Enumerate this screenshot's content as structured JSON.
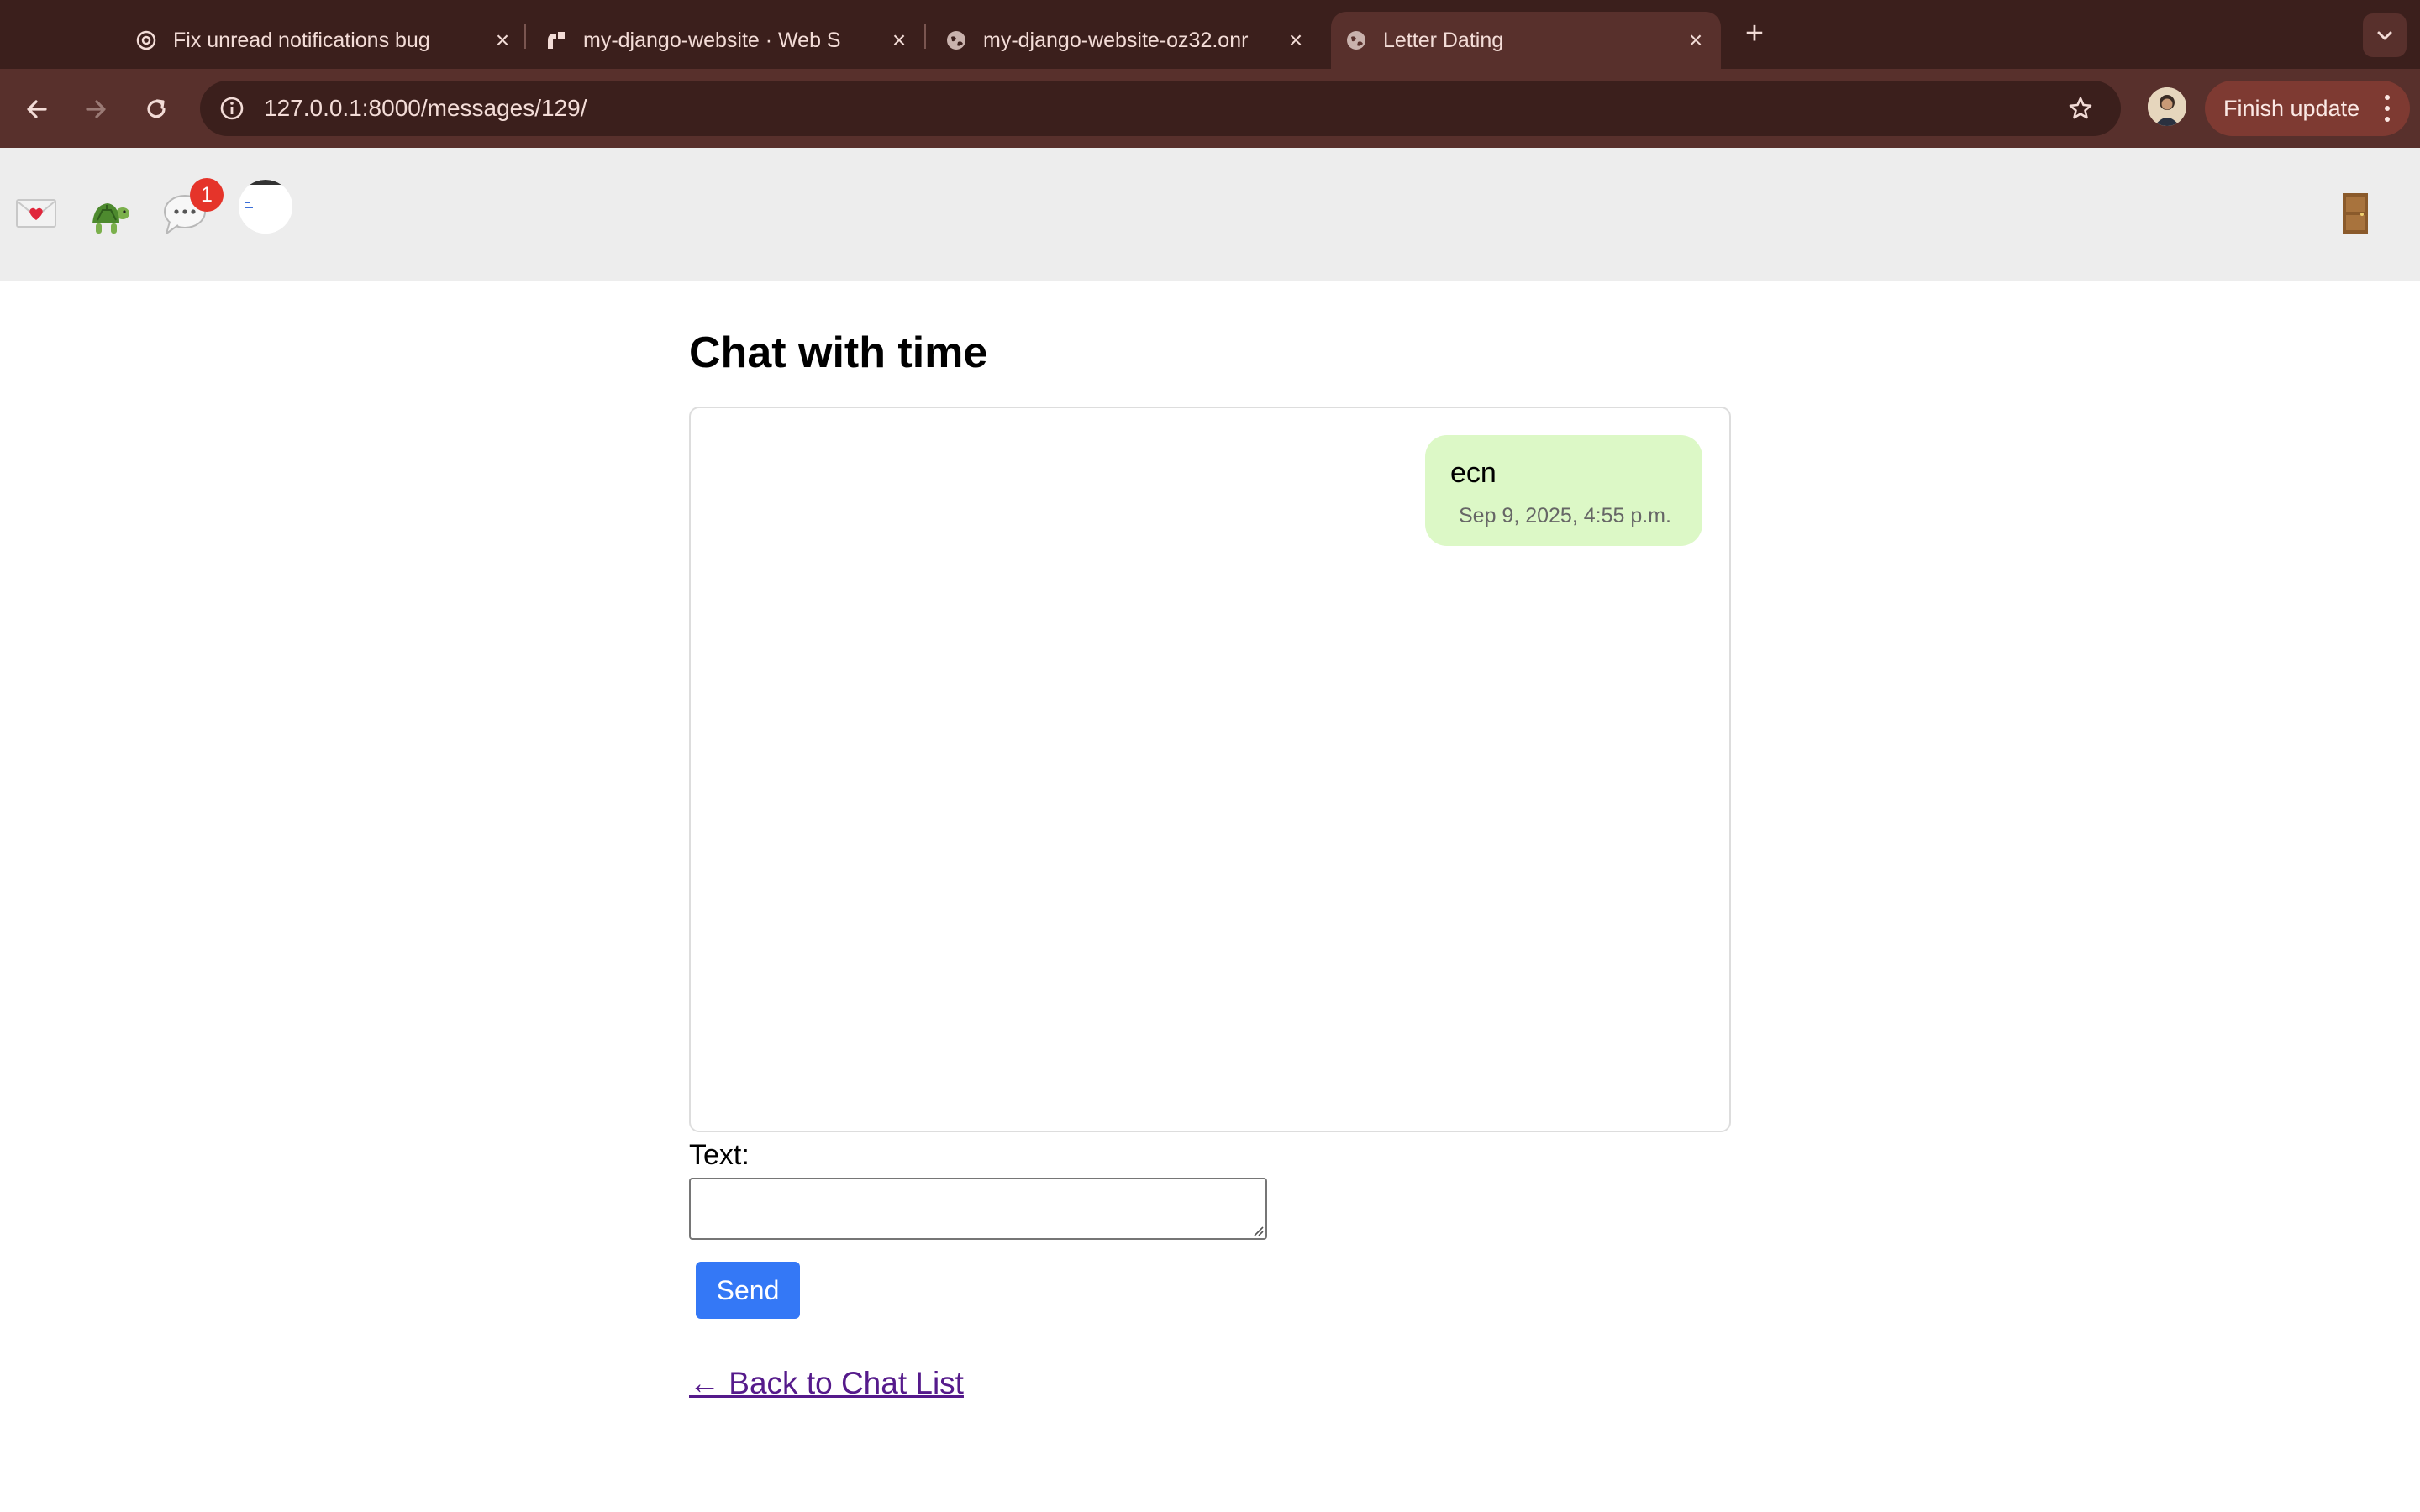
{
  "browser": {
    "tabs": [
      {
        "title": "Fix unread notifications bug",
        "icon": "openai-icon",
        "active": false
      },
      {
        "title": "my-django-website · Web S",
        "icon": "render-icon",
        "active": false
      },
      {
        "title": "my-django-website-oz32.onr",
        "icon": "globe-icon",
        "active": false
      },
      {
        "title": "Letter Dating",
        "icon": "globe-icon",
        "active": true
      }
    ],
    "url": "127.0.0.1:8000/messages/129/",
    "finish_update_label": "Finish update",
    "colors": {
      "tabbar": "#3b1f1c",
      "toolbar": "#58302c",
      "finish_update": "#7e3a32"
    }
  },
  "site_header": {
    "nav_icons": [
      "love-letter-icon",
      "turtle-icon",
      "speech-bubble-icon",
      "user-avatar",
      "door-icon"
    ],
    "unread_count": "1"
  },
  "page": {
    "title": "Chat with time",
    "messages": [
      {
        "text": "ecn",
        "timestamp": "Sep 9, 2025, 4:55 p.m.",
        "sent": true
      }
    ],
    "form": {
      "text_label": "Text:",
      "text_value": "",
      "send_label": "Send"
    },
    "back_link": "← Back to Chat List",
    "colors": {
      "sent_bubble": "#dcf8c6",
      "send_button": "#3478f6",
      "link_visited": "#551a8b"
    }
  }
}
